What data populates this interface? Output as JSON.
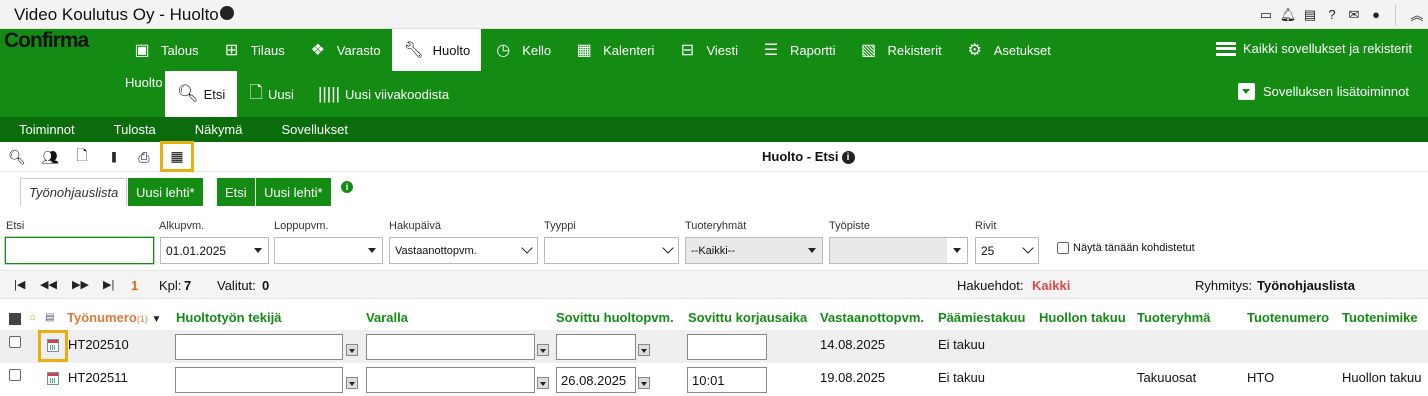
{
  "titlebar": {
    "title": "Video Koulutus Oy - Huolto"
  },
  "brand": {
    "logo": "Confirma",
    "accent": "#148c14",
    "dark_accent": "#0a6c0a",
    "highlight": "#e8b00f"
  },
  "nav": {
    "items": [
      {
        "label": "Talous",
        "icon": "money-icon"
      },
      {
        "label": "Tilaus",
        "icon": "grid-icon"
      },
      {
        "label": "Varasto",
        "icon": "boxes-icon"
      },
      {
        "label": "Huolto",
        "icon": "wrench-icon",
        "active": true
      },
      {
        "label": "Kello",
        "icon": "clock-icon"
      },
      {
        "label": "Kalenteri",
        "icon": "calendar-icon"
      },
      {
        "label": "Viesti",
        "icon": "inbox-icon"
      },
      {
        "label": "Raportti",
        "icon": "chart-icon"
      },
      {
        "label": "Rekisterit",
        "icon": "register-icon"
      },
      {
        "label": "Asetukset",
        "icon": "gears-icon"
      }
    ],
    "all_apps": "Kaikki sovellukset ja rekisterit"
  },
  "subnav": {
    "section": "Huolto",
    "items": [
      {
        "label": "Etsi"
      },
      {
        "label": "Uusi"
      },
      {
        "label": "Uusi viivakoodista"
      }
    ],
    "additional": "Sovelluksen lisätoiminnot"
  },
  "menubar": [
    "Toiminnot",
    "Tulosta",
    "Näkymä",
    "Sovellukset"
  ],
  "page": {
    "title": "Huolto - Etsi"
  },
  "tabs": [
    "Työnohjauslista",
    "Uusi lehti*",
    "Etsi",
    "Uusi lehti*"
  ],
  "filters": {
    "etsi": {
      "label": "Etsi",
      "value": ""
    },
    "alkupvm": {
      "label": "Alkupvm.",
      "value": "01.01.2025"
    },
    "loppupvm": {
      "label": "Loppupvm.",
      "value": ""
    },
    "hakupaiva": {
      "label": "Hakupäivä",
      "value": "Vastaanottopvm."
    },
    "tyyppi": {
      "label": "Tyyppi",
      "value": ""
    },
    "tuoteryhmat": {
      "label": "Tuoteryhmät",
      "value": "--Kaikki--"
    },
    "tyopiste": {
      "label": "Työpiste",
      "value": ""
    },
    "rivit": {
      "label": "Rivit",
      "value": "25"
    },
    "today_check": "Näytä tänään kohdistetut"
  },
  "pager": {
    "page": "1",
    "kpl_label": "Kpl:",
    "kpl": "7",
    "valitut_label": "Valitut:",
    "valitut": "0",
    "hakuehdot_label": "Hakuehdot:",
    "hakuehdot": "Kaikki",
    "ryhmitys_label": "Ryhmitys:",
    "ryhmitys": "Työnohjauslista"
  },
  "columns": {
    "tyonumero": "Työnumero",
    "sort": "(1)",
    "tekija": "Huoltotyön tekijä",
    "varalla": "Varalla",
    "sovittu_pvm": "Sovittu huoltopvm.",
    "sovittu_aika": "Sovittu korjausaika",
    "vastaanotto": "Vastaanottopvm.",
    "paamies": "Päämiestakuu",
    "huollon_takuu": "Huollon takuu",
    "tuoteryhma": "Tuoteryhmä",
    "tuotenumero": "Tuotenumero",
    "tuotenimike": "Tuotenimike"
  },
  "rows": [
    {
      "tyonumero": "HT202510",
      "tekija": "",
      "varalla": "",
      "sovittu_pvm": "",
      "sovittu_aika": "",
      "vastaanotto": "14.08.2025",
      "paamies": "Ei takuu",
      "huollon_takuu": "",
      "tuoteryhma": "",
      "tuotenumero": "",
      "tuotenimike": ""
    },
    {
      "tyonumero": "HT202511",
      "tekija": "",
      "varalla": "",
      "sovittu_pvm": "26.08.2025",
      "sovittu_aika": "10:01",
      "vastaanotto": "19.08.2025",
      "paamies": "Ei takuu",
      "huollon_takuu": "",
      "tuoteryhma": "Takuuosat",
      "tuotenumero": "HTO",
      "tuotenimike": "Huollon takuu"
    }
  ]
}
